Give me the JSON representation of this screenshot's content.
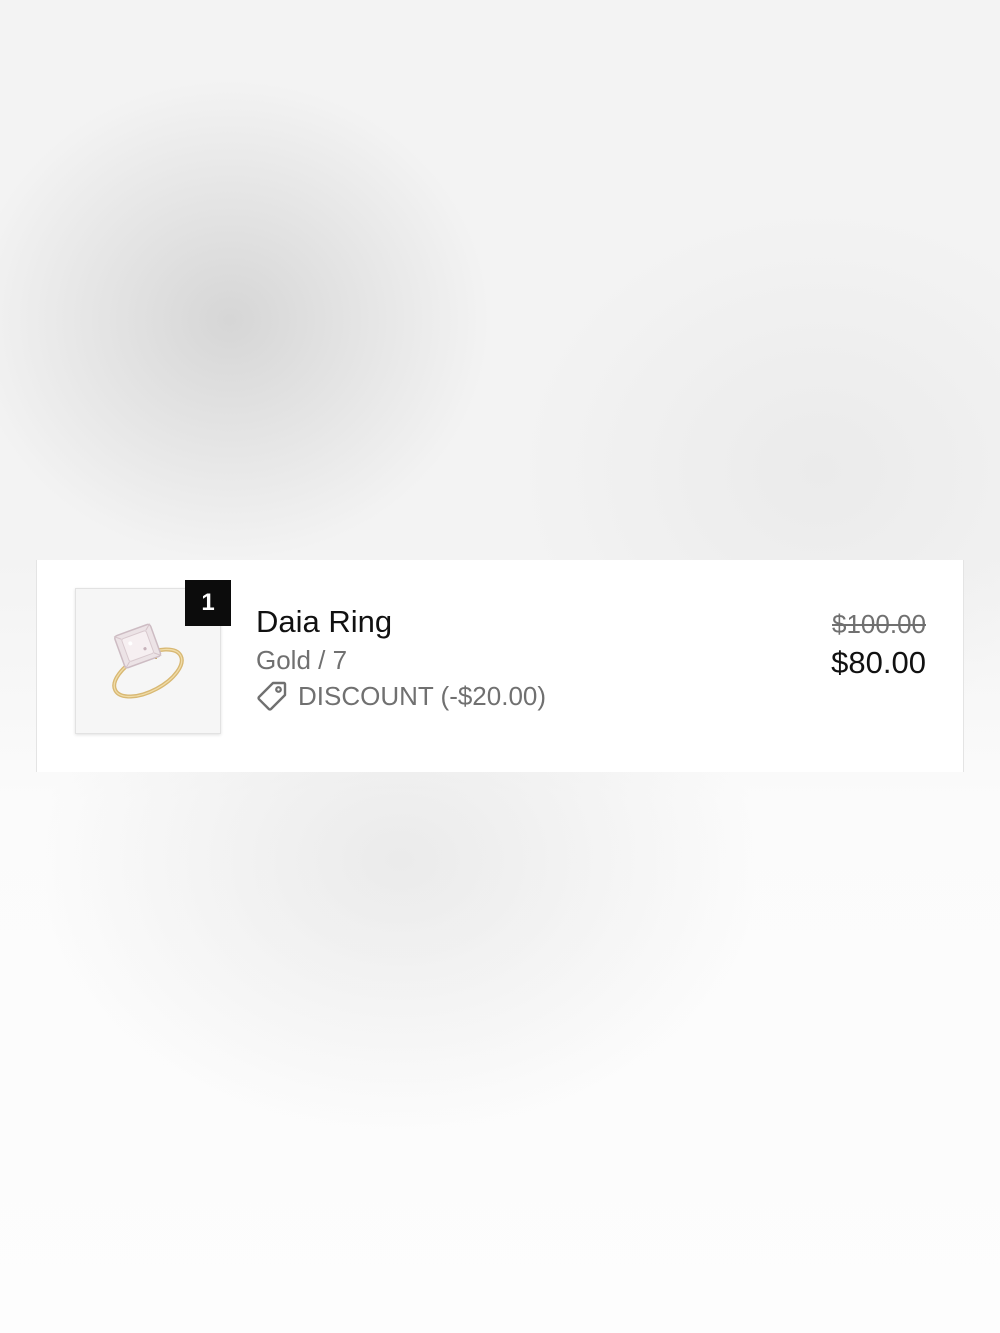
{
  "line_item": {
    "quantity": "1",
    "name": "Daia Ring",
    "variant": "Gold / 7",
    "discount_label": "DISCOUNT (-$20.00)",
    "original_price": "$100.00",
    "final_price": "$80.00",
    "image_icon": "ring-product-image",
    "discount_icon": "tag-icon"
  }
}
